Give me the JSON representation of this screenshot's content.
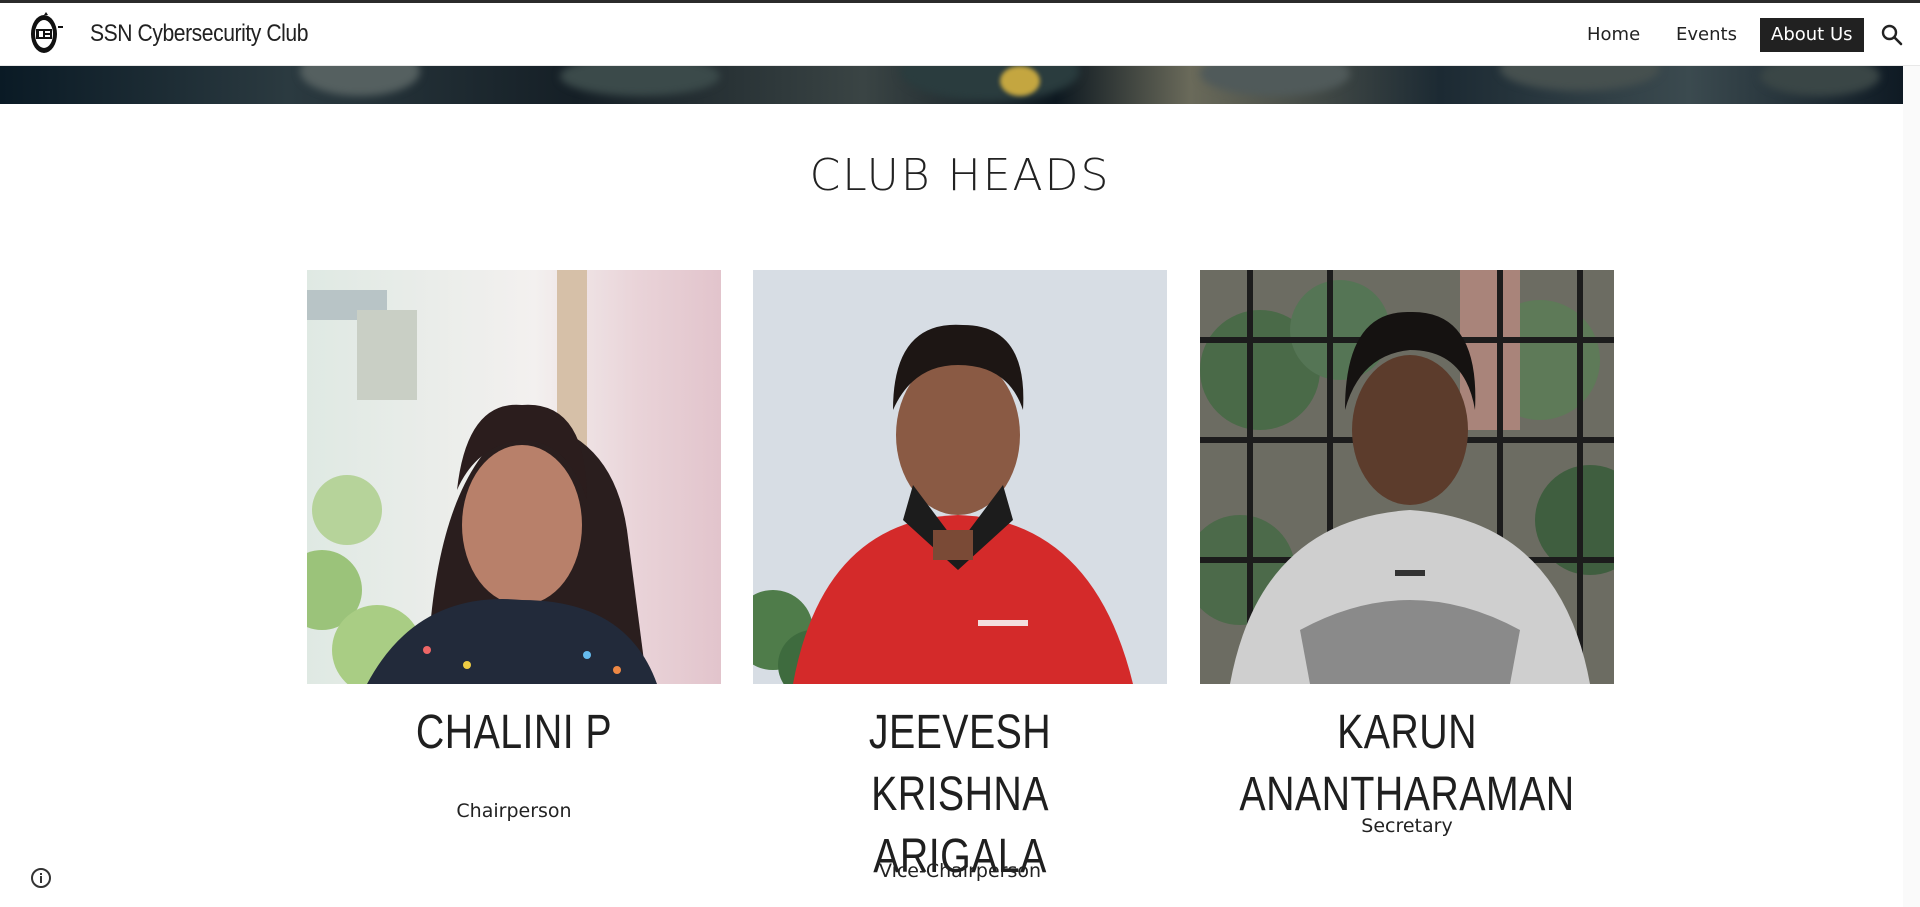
{
  "site": {
    "title": "SSN Cybersecurity Club"
  },
  "nav": {
    "items": [
      "Home",
      "Events",
      "About Us"
    ],
    "active": "About Us"
  },
  "section": {
    "title": "CLUB HEADS"
  },
  "heads": [
    {
      "name": "CHALINI P",
      "role": "Chairperson"
    },
    {
      "name": "JEEVESH KRISHNA ARIGALA",
      "role": "Vice-Chairperson"
    },
    {
      "name": "KARUN ANANTHARAMAN",
      "role": "Secretary"
    }
  ],
  "icons": {
    "search": "search-icon",
    "info": "info-icon",
    "logo": "club-logo"
  },
  "colors": {
    "active_nav_bg": "#212121",
    "text": "#212121"
  }
}
